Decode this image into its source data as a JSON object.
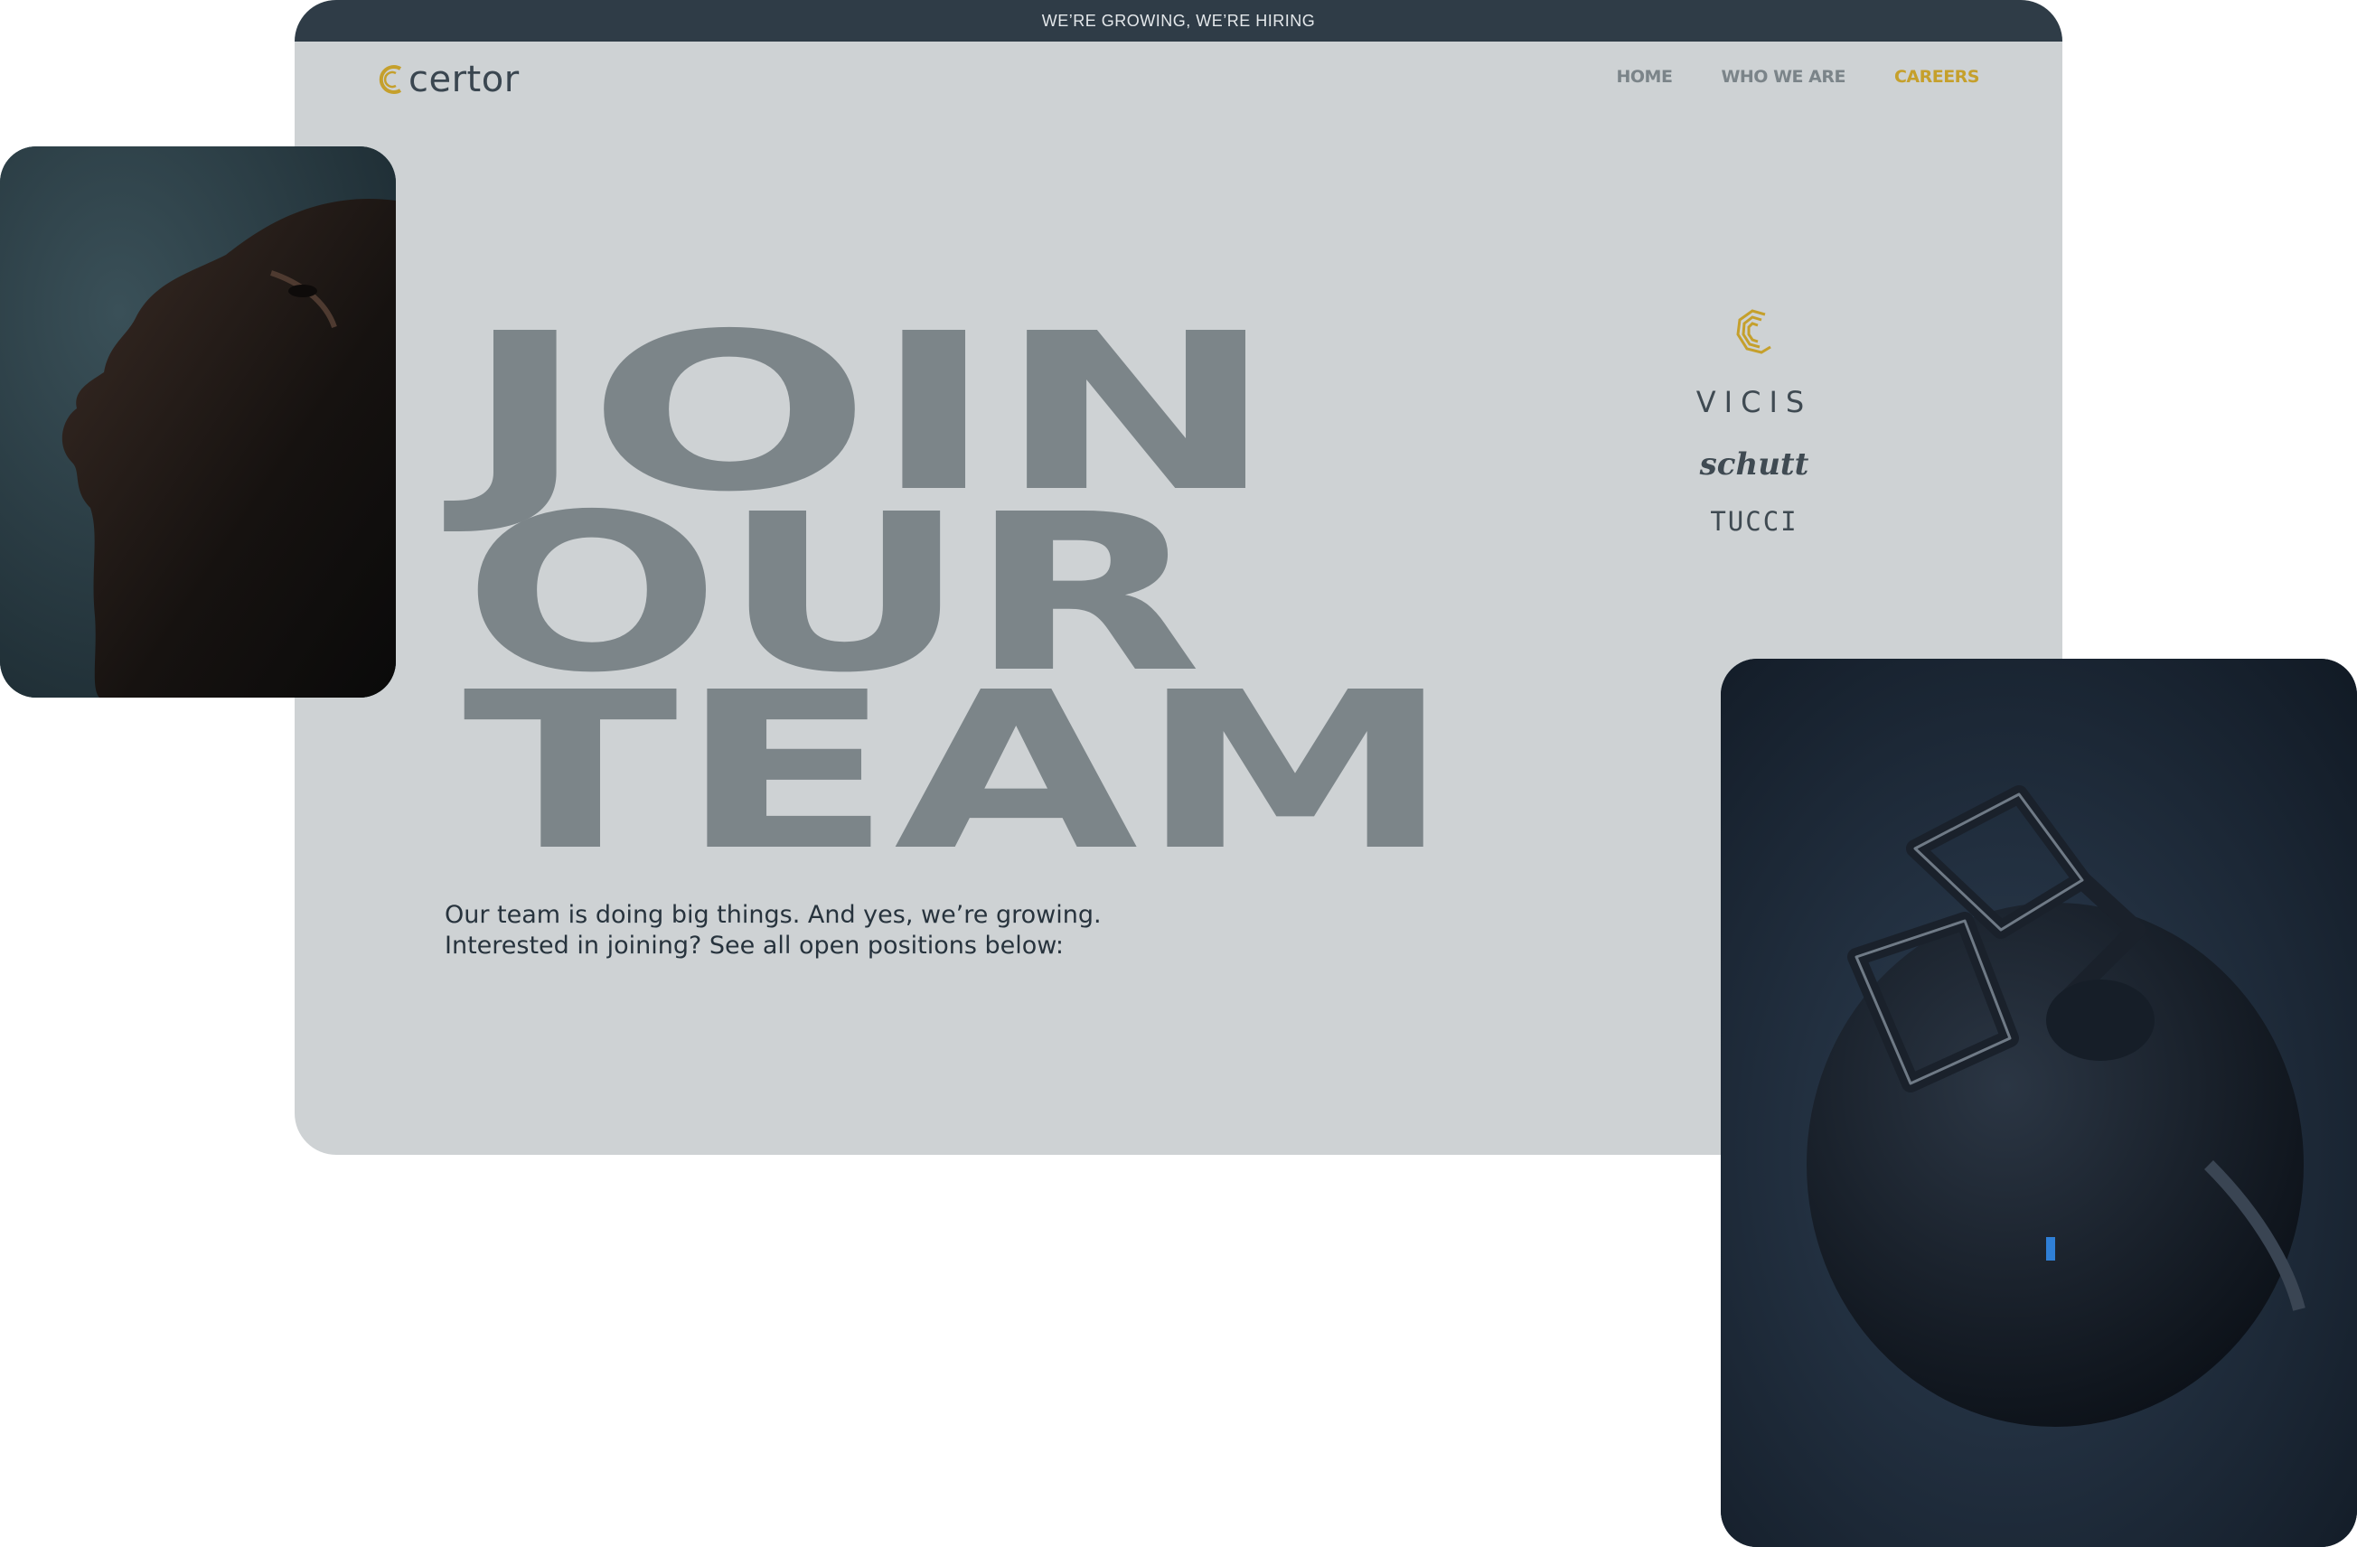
{
  "announcement": "WE’RE GROWING, WE’RE HIRING",
  "logo": {
    "text": "certor",
    "icon": "certor-c-icon"
  },
  "nav": {
    "items": [
      {
        "label": "HOME",
        "active": false
      },
      {
        "label": "WHO WE ARE",
        "active": false
      },
      {
        "label": "CAREERS",
        "active": true
      }
    ]
  },
  "hero": {
    "line1": "JOIN",
    "line2": "OUR",
    "line3": "TEAM",
    "intro_line1": "Our team is doing big things. And yes, we’re growing.",
    "intro_line2": "Interested in joining? See all open positions below:"
  },
  "brands": {
    "items": [
      {
        "name": "certor-mark-icon",
        "label": ""
      },
      {
        "name": "vicis",
        "label": "VICIS"
      },
      {
        "name": "schutt",
        "label": "schutt"
      },
      {
        "name": "tucci",
        "label": "TUCCI"
      }
    ]
  },
  "images": {
    "left": "athlete-portrait-image",
    "right": "football-helmet-image"
  },
  "colors": {
    "accent": "#c5a02c",
    "frame_bg": "#ced2d4",
    "topbar_bg": "#2f3c47",
    "headline": "#7c8589",
    "text_dark": "#27333d"
  }
}
